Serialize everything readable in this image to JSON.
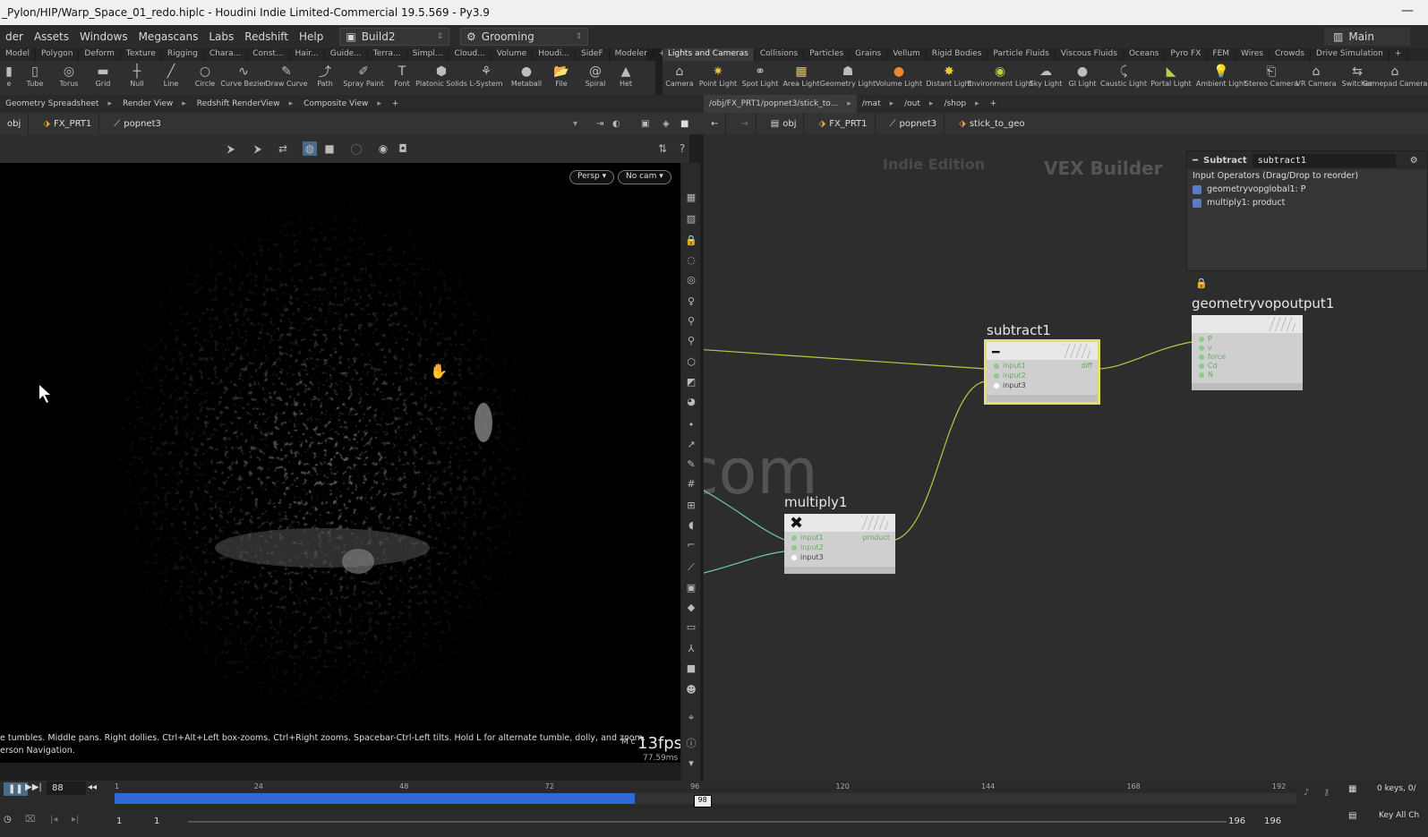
{
  "window": {
    "title": "_Pylon/HIP/Warp_Space_01_redo.hiplc - Houdini Indie Limited-Commercial 19.5.569 - Py3.9",
    "minimize": "—"
  },
  "menu": {
    "items": [
      "der",
      "Assets",
      "Windows",
      "Megascans",
      "Labs",
      "Redshift",
      "Help"
    ],
    "desktop": "Build2",
    "context": "Grooming",
    "main_desktop": "Main"
  },
  "shelf_left": {
    "tabs": [
      "Model",
      "Polygon",
      "Deform",
      "Texture",
      "Rigging",
      "Chara...",
      "Const...",
      "Hair...",
      "Guide...",
      "Terra...",
      "Simpl...",
      "Cloud...",
      "Volume",
      "Houdi...",
      "SideF",
      "Modeler"
    ],
    "tools": [
      {
        "label": "e",
        "icon": "shape-icon"
      },
      {
        "label": "Tube",
        "icon": "tube-icon"
      },
      {
        "label": "Torus",
        "icon": "torus-icon"
      },
      {
        "label": "Grid",
        "icon": "grid-icon"
      },
      {
        "label": "Null",
        "icon": "null-icon"
      },
      {
        "label": "Line",
        "icon": "line-icon"
      },
      {
        "label": "Circle",
        "icon": "circle-icon"
      },
      {
        "label": "Curve Bezier",
        "icon": "curve-icon"
      },
      {
        "label": "Draw Curve",
        "icon": "pencil-icon"
      },
      {
        "label": "Path",
        "icon": "path-icon"
      },
      {
        "label": "Spray Paint",
        "icon": "spray-icon"
      },
      {
        "label": "Font",
        "icon": "font-icon"
      },
      {
        "label": "Platonic Solids",
        "icon": "platonic-icon"
      },
      {
        "label": "L-System",
        "icon": "lsystem-icon"
      },
      {
        "label": "Metaball",
        "icon": "metaball-icon"
      },
      {
        "label": "File",
        "icon": "file-icon"
      },
      {
        "label": "Spiral",
        "icon": "spiral-icon"
      },
      {
        "label": "Het",
        "icon": "het-icon"
      }
    ]
  },
  "shelf_right": {
    "tabs": [
      "Lights and Cameras",
      "Collisions",
      "Particles",
      "Grains",
      "Vellum",
      "Rigid Bodies",
      "Particle Fluids",
      "Viscous Fluids",
      "Oceans",
      "Pyro FX",
      "FEM",
      "Wires",
      "Crowds",
      "Drive Simulation"
    ],
    "tools": [
      {
        "label": "Camera",
        "icon": "camera-icon"
      },
      {
        "label": "Point Light",
        "icon": "point-light-icon"
      },
      {
        "label": "Spot Light",
        "icon": "spot-light-icon"
      },
      {
        "label": "Area Light",
        "icon": "area-light-icon"
      },
      {
        "label": "Geometry Light",
        "icon": "geometry-light-icon"
      },
      {
        "label": "Volume Light",
        "icon": "volume-light-icon"
      },
      {
        "label": "Distant Light",
        "icon": "distant-light-icon"
      },
      {
        "label": "Environment Light",
        "icon": "environment-light-icon"
      },
      {
        "label": "Sky Light",
        "icon": "sky-light-icon"
      },
      {
        "label": "GI Light",
        "icon": "gi-light-icon"
      },
      {
        "label": "Caustic Light",
        "icon": "caustic-light-icon"
      },
      {
        "label": "Portal Light",
        "icon": "portal-light-icon"
      },
      {
        "label": "Ambient Light",
        "icon": "ambient-light-icon"
      },
      {
        "label": "Stereo Camera",
        "icon": "stereo-camera-icon"
      },
      {
        "label": "VR Camera",
        "icon": "vr-camera-icon"
      },
      {
        "label": "Switcher",
        "icon": "switcher-icon"
      },
      {
        "label": "Gamepad Camera",
        "icon": "gamepad-camera-icon"
      }
    ]
  },
  "panes_left": {
    "tabs": [
      "Geometry Spreadsheet",
      "Render View",
      "Redshift RenderView",
      "Composite View"
    ],
    "path": [
      "obj",
      "FX_PRT1",
      "popnet3"
    ]
  },
  "panes_right": {
    "tabs": [
      "/obj/FX_PRT1/popnet3/stick_to...",
      "/mat",
      "/out",
      "/shop"
    ],
    "path": [
      "obj",
      "FX_PRT1",
      "popnet3",
      "stick_to_geo"
    ]
  },
  "viewport": {
    "persp": "Persp ▾",
    "cam": "No cam ▾",
    "help_line1": "e tumbles. Middle pans. Right dollies. Ctrl+Alt+Left box-zooms. Ctrl+Right zooms. Spacebar-Ctrl-Left tilts. Hold L for alternate tumble, dolly, and zoom.",
    "help_line2": "erson Navigation.",
    "fps_prefix": "M c",
    "fps": "13fps",
    "ms": "77.59ms"
  },
  "network": {
    "watermark_indie": "Indie Edition",
    "watermark_vex": "VEX Builder",
    "site_watermark": "iiivfx.com",
    "nodes": {
      "subtract": {
        "name": "subtract1",
        "inputs": [
          "input1",
          "input2",
          "input3"
        ],
        "output": "diff"
      },
      "multiply": {
        "name": "multiply1",
        "inputs": [
          "input1",
          "input2",
          "input3"
        ],
        "output": "product"
      },
      "output": {
        "name": "geometryvopoutput1",
        "inputs": [
          "P",
          "v",
          "force",
          "Cd",
          "N"
        ]
      }
    }
  },
  "params": {
    "type": "Subtract",
    "name": "subtract1",
    "header": "Input Operators (Drag/Drop to reorder)",
    "inputs": [
      "geometryvopglobal1: P",
      "multiply1: product"
    ]
  },
  "timeline": {
    "current_frame": "88",
    "playhead": "98",
    "ticks": [
      "1",
      "24",
      "48",
      "72",
      "96",
      "120",
      "144",
      "168",
      "192"
    ],
    "progress": 0.44,
    "start": "1",
    "start2": "1",
    "end": "196",
    "end2": "196",
    "keys": "0 keys, 0/",
    "key_all": "Key All Ch"
  }
}
